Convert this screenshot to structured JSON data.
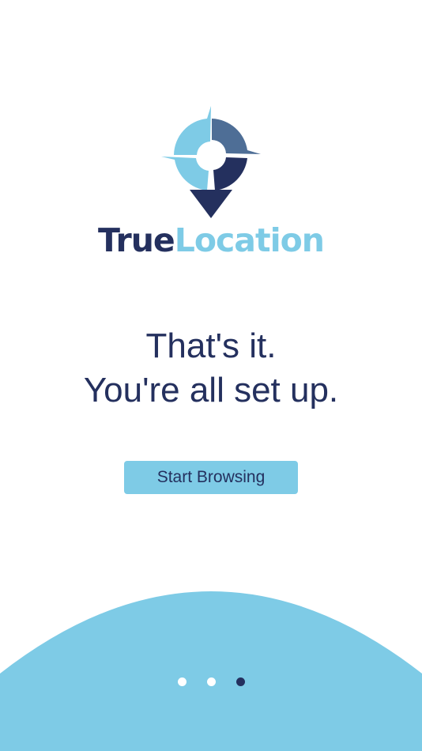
{
  "brand": {
    "name_part1": "True",
    "name_part2": "Location",
    "color_dark": "#24305e",
    "color_light": "#7ecbe6",
    "color_mid": "#4e6e96",
    "logo_icon": "compass-pin-icon"
  },
  "onboarding": {
    "headline_line1": "That's it.",
    "headline_line2": "You're all set up.",
    "start_button_label": "Start Browsing",
    "page_count": 3,
    "current_page": 3
  },
  "colors": {
    "background": "#ffffff",
    "accent": "#7ecbe6",
    "text": "#24305e"
  }
}
